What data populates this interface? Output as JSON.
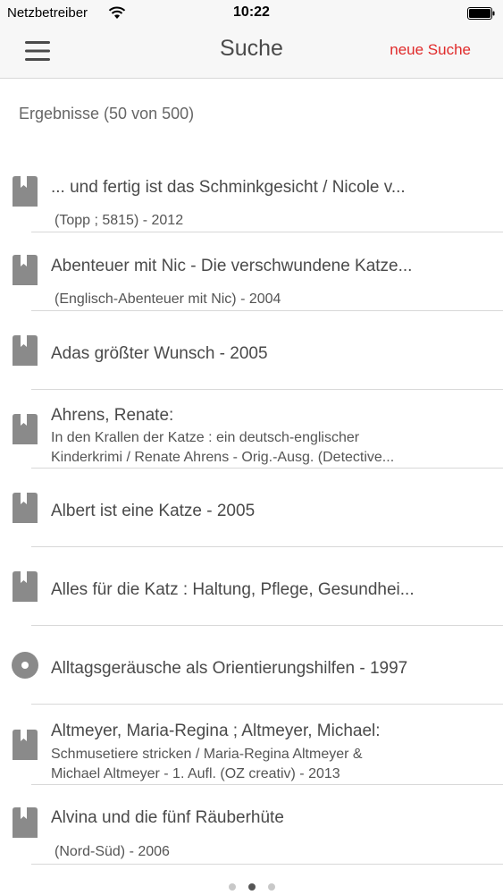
{
  "status_bar": {
    "carrier": "Netzbetreiber",
    "time": "10:22"
  },
  "nav": {
    "menu_icon": "hamburger-menu-icon",
    "title": "Suche",
    "new_search_label": "neue Suche"
  },
  "colors": {
    "accent": "#e02a2a",
    "text": "#4a4a4a",
    "icon": "#8a8a8a",
    "divider": "#d8d8d8",
    "bar_background": "#f7f7f7"
  },
  "results": {
    "header": "Ergebnisse (50 von 500)",
    "items": [
      {
        "icon": "book-icon",
        "title": "... und fertig ist das Schminkgesicht / Nicole v...",
        "lines": [
          "(Topp ; 5815) - 2012"
        ]
      },
      {
        "icon": "book-icon",
        "title": "Abenteuer mit Nic - Die verschwundene Katze...",
        "lines": [
          "(Englisch-Abenteuer mit Nic) - 2004"
        ]
      },
      {
        "icon": "book-icon",
        "title": "Adas größter Wunsch - 2005",
        "lines": []
      },
      {
        "icon": "book-icon",
        "title": "Ahrens, Renate:",
        "lines": [
          "In den Krallen der Katze : ein deutsch-englischer",
          "Kinderkrimi / Renate Ahrens - Orig.-Ausg.  (Detective..."
        ]
      },
      {
        "icon": "book-icon",
        "title": "Albert ist eine Katze - 2005",
        "lines": []
      },
      {
        "icon": "book-icon",
        "title": "Alles für die Katz : Haltung, Pflege, Gesundhei...",
        "lines": []
      },
      {
        "icon": "disc-icon",
        "title": "Alltagsgeräusche als Orientierungshilfen - 1997",
        "lines": []
      },
      {
        "icon": "book-icon",
        "title": "Altmeyer, Maria-Regina ; Altmeyer, Michael:",
        "lines": [
          "Schmusetiere stricken / Maria-Regina Altmeyer &",
          "Michael Altmeyer - 1. Aufl.  (OZ creativ) - 2013"
        ]
      },
      {
        "icon": "book-icon",
        "title": "Alvina und die fünf Räuberhüte",
        "lines": [
          "(Nord-Süd) - 2006"
        ]
      }
    ]
  },
  "pagination": {
    "pages": 3,
    "current": 2
  }
}
